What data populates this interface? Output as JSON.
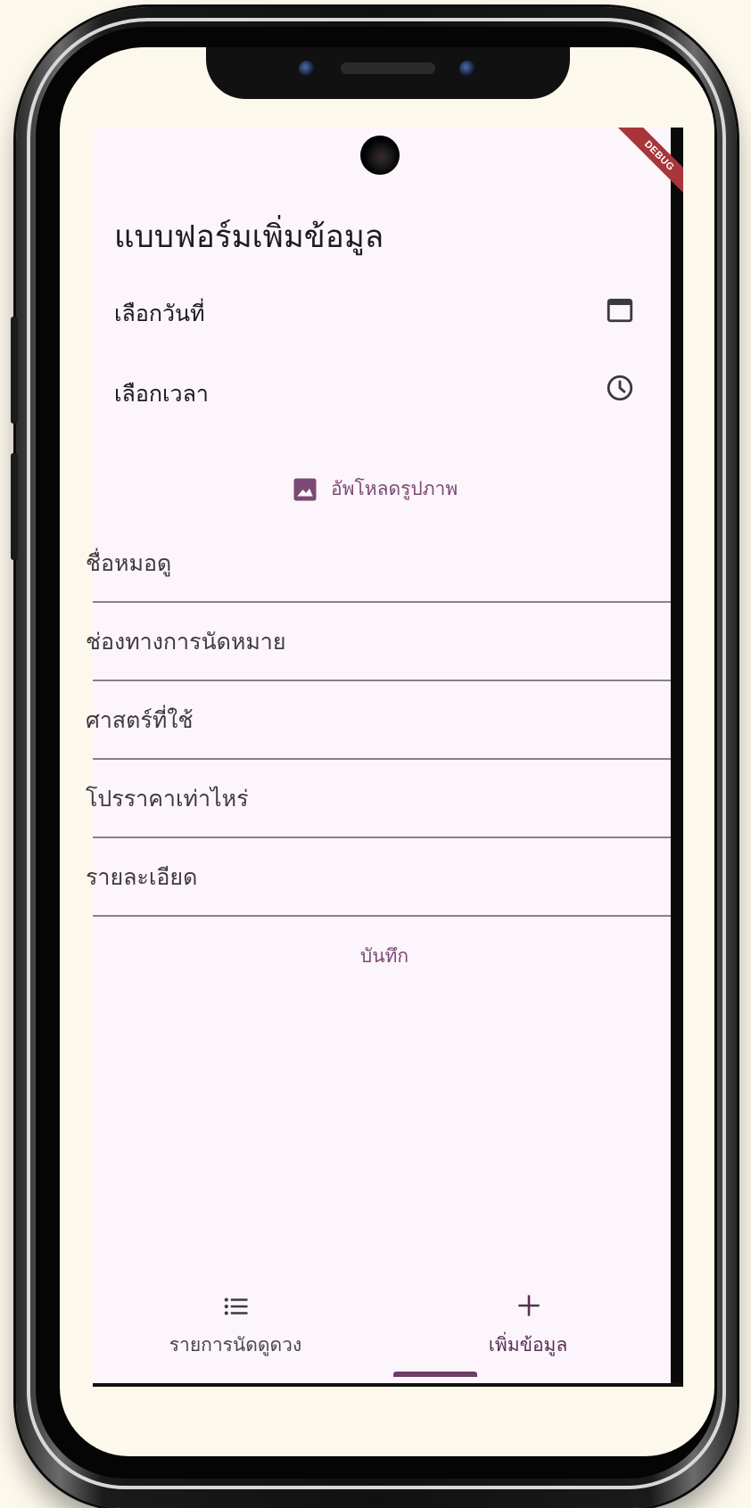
{
  "form": {
    "title": "แบบฟอร์มเพิ่มข้อมูล",
    "date_label": "เลือกวันที่",
    "time_label": "เลือกเวลา",
    "upload_label": "อัพโหลดรูปภาพ",
    "fields": [
      {
        "label": "ชื่อหมอดู"
      },
      {
        "label": "ช่องทางการนัดหมาย"
      },
      {
        "label": "ศาสตร์ที่ใช้"
      },
      {
        "label": "โปรราคาเท่าไหร่"
      },
      {
        "label": "รายละเอียด"
      }
    ],
    "save_label": "บันทึก"
  },
  "debug_banner": "DEBUG",
  "bottom_nav": {
    "items": [
      {
        "label": "รายการนัดดูดวง",
        "icon": "list-icon",
        "active": false
      },
      {
        "label": "เพิ่มข้อมูล",
        "icon": "add-icon",
        "active": true
      }
    ]
  },
  "colors": {
    "background": "#fdf8ec",
    "screen": "#fcf5fb",
    "primary": "#7b4a74",
    "debug": "#a8353a"
  }
}
